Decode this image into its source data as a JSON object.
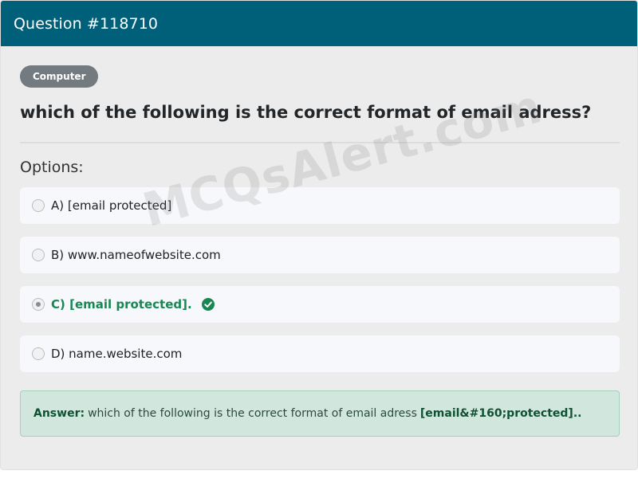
{
  "header": {
    "title": "Question #118710"
  },
  "question": {
    "category": "Computer",
    "text": "which of the following is the correct format of email adress?"
  },
  "options_label": "Options:",
  "options": [
    {
      "label": "A) [email protected]",
      "selected": false,
      "correct": false
    },
    {
      "label": "B) www.nameofwebsite.com",
      "selected": false,
      "correct": false
    },
    {
      "label": "C) [email protected].",
      "selected": true,
      "correct": true
    },
    {
      "label": "D) name.website.com",
      "selected": false,
      "correct": false
    }
  ],
  "answer": {
    "label": "Answer:",
    "text": "which of the following is the correct format of email adress",
    "value": "[email&#160;protected]..",
    "value_display": "[email&#160;protected].."
  },
  "watermark": "MCQsAlert.com",
  "colors": {
    "header_bg": "#00607a",
    "correct": "#198754",
    "answer_bg": "#d1e7dd"
  },
  "icons": {
    "correct_option": "check-circle-icon"
  }
}
